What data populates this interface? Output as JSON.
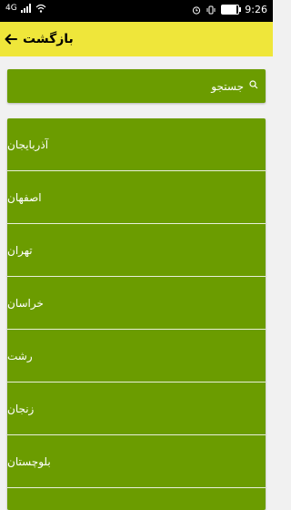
{
  "status_bar": {
    "network": "4G",
    "time": "9:26",
    "battery_level": 0.85
  },
  "app_bar": {
    "title": "بازگشت"
  },
  "search": {
    "placeholder": "جستجو"
  },
  "provinces": [
    "آذربایجان",
    "اصفهان",
    "تهران",
    "خراسان",
    "رشت",
    "زنجان",
    "بلوچستان"
  ],
  "colors": {
    "app_bar": "#efe63a",
    "card": "#6b9c00",
    "background": "#f1f1f1"
  }
}
